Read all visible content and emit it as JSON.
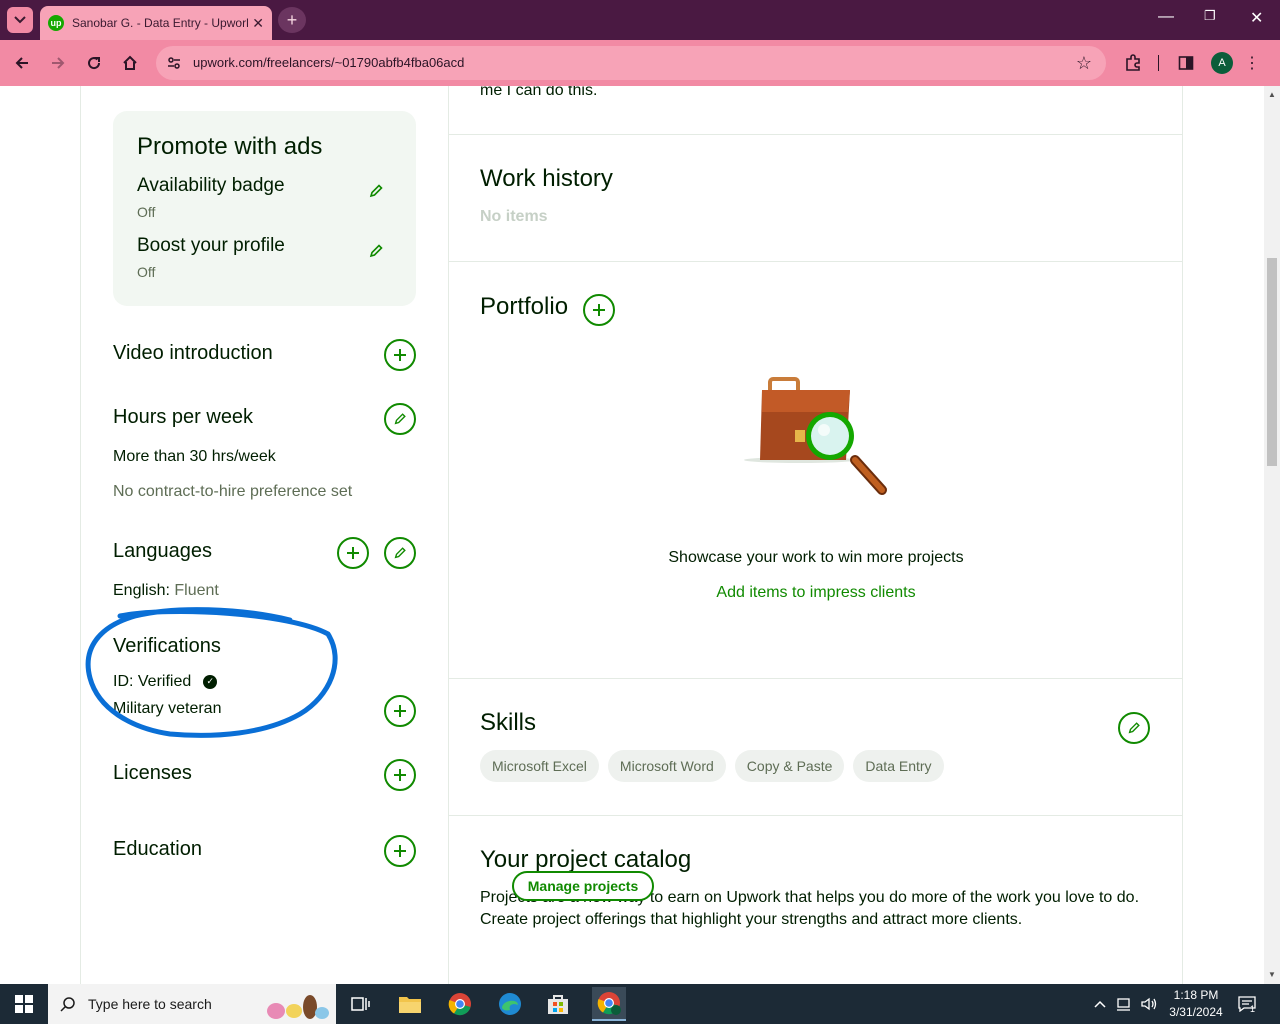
{
  "browser": {
    "tab_title": "Sanobar G. - Data Entry - Upwork",
    "url": "upwork.com/freelancers/~01790abfb4fba06acd",
    "profile_initial": "A",
    "theme_color": "#f28aa4"
  },
  "page": {
    "clipped_text": "me I can do this.",
    "promote": {
      "title": "Promote with ads",
      "items": [
        {
          "title": "Availability badge",
          "status": "Off"
        },
        {
          "title": "Boost your profile",
          "status": "Off"
        }
      ]
    },
    "video_intro": {
      "title": "Video introduction"
    },
    "hours": {
      "title": "Hours per week",
      "value": "More than 30 hrs/week",
      "preference": "No contract-to-hire preference set"
    },
    "languages": {
      "title": "Languages",
      "entries": [
        {
          "language": "English:",
          "level": "Fluent"
        }
      ]
    },
    "verifications": {
      "title": "Verifications",
      "id_status": "ID: Verified",
      "military": "Military veteran"
    },
    "licenses": {
      "title": "Licenses"
    },
    "education": {
      "title": "Education"
    },
    "work_history": {
      "title": "Work history",
      "empty": "No items"
    },
    "portfolio": {
      "title": "Portfolio",
      "cta_text": "Showcase your work to win more projects",
      "cta_link": "Add items to impress clients"
    },
    "skills": {
      "title": "Skills",
      "items": [
        "Microsoft Excel",
        "Microsoft Word",
        "Copy & Paste",
        "Data Entry"
      ]
    },
    "catalog": {
      "title": "Your project catalog",
      "line1": "Projects are a new way to earn on Upwork that helps you do more of the work you love to do.",
      "line2": "Create project offerings that highlight your strengths and attract more clients.",
      "button": "Manage projects"
    },
    "brand_green": "#108a00",
    "annotation_color": "#0a6fd6"
  },
  "taskbar": {
    "search_placeholder": "Type here to search",
    "time": "1:18 PM",
    "date": "3/31/2024",
    "notification_count": "1"
  }
}
